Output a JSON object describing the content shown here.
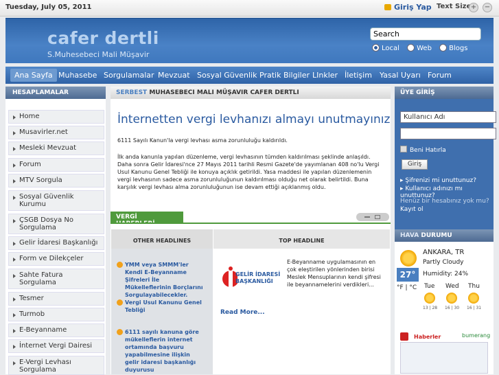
{
  "topbar": {
    "date": "Tuesday, July 05, 2011",
    "login": "Giriş Yap",
    "text_size": "Text Size",
    "size_plus": "+",
    "size_minus": "−"
  },
  "header": {
    "site_name": "cafer dertli",
    "subtitle": "S.Muhesebeci Mali Müşavir",
    "search_value": "Search",
    "radios": [
      {
        "label": "Local",
        "checked": true
      },
      {
        "label": "Web",
        "checked": false
      },
      {
        "label": "Blogs",
        "checked": false
      }
    ]
  },
  "nav": [
    "Ana Sayfa",
    "Muhasebe",
    "Sorgulamalar",
    "Mevzuat",
    "Sosyal Güvenlik",
    "Pratik Bilgiler",
    "LInkler",
    "İletişim",
    "Yasal Uyarı",
    "Forum"
  ],
  "left": {
    "title": "HESAPLAMALAR",
    "items": [
      "Home",
      "Musavirler.net",
      "Mesleki Mevzuat",
      "Forum",
      "MTV Sorgula",
      "Sosyal Güvenlik Kurumu",
      "ÇSGB Dosya No Sorgulama",
      "Gelir İdaresi Başkanlığı",
      "Form ve Dilekçeler",
      "Sahte Fatura Sorgulama",
      "Tesmer",
      "Turmob",
      "E-Beyanname",
      "İnternet Vergi Dairesi",
      "E-Vergi Levhası Sorgulama"
    ]
  },
  "main": {
    "head_accent": "SERBEST",
    "head_title": "MUHASEBECI MALI MÜŞAVIR CAFER DERTLI",
    "headline": "İnternetten vergi levhanızı almayı unutmayınız",
    "para1": "6111 Sayılı Kanun'la vergi levhası asma zorunluluğu kaldırıldı.",
    "para2": "İlk anda kanunla yapılan düzenleme, vergi levhasının tümden kaldırılması şeklinde anlaşıldı. Daha sonra Gelir İdaresi'nce 27 Mayıs 2011 tarihli Resmi Gazete'de yayımlanan 408 no'lu Vergi Usul Kanunu Genel Tebliği ile konuya açıklık getirildi. Yasa maddesi ile yapılan düzenlemenin vergi levhasının sadece asma zorunluluğunun kaldırılması olduğu net olarak belirtildi. Buna karşılık vergi levhası alma zorunluluğunun ise devam ettiği açıklanmış oldu.",
    "tab": "VERGİ HABERLERİ",
    "other_headlines": "OTHER HEADLINES",
    "top_headline": "TOP HEADLINE",
    "news": [
      "YMM veya SMMM'ler Kendi E-Beyanname Şifreleri İle Mükelleflerinin Borçlarını Sorgulayabilecekler.",
      "Vergi Usul Kanunu Genel Tebliği",
      "6111 sayılı kanuna göre mükelleflerin internet ortamında başvuru yapabilmesine ilişkin gelir idaresi başkanlığı duyurusu"
    ],
    "logo_text": "GELİR İDARESİ BAŞKANLIĞI",
    "top_text": "E-Beyanname uygulamasının en çok eleştirilen yönlerinden birisi Meslek Mensuplarının kendi şifresi ile beyannamelerini verdikleri...",
    "read_more": "Read More..."
  },
  "right": {
    "login_title": "ÜYE GİRİŞ",
    "username": "Kullanıcı Adı",
    "remember": "Beni Hatırla",
    "login_btn": "Giriş",
    "forgot_pw": "Şifrenizi mi unuttunuz?",
    "forgot_user": "Kullanıcı adınızı mı unuttunuz?",
    "no_account": "Henüz bir hesabınız yok mu?",
    "register": "Kayıt ol",
    "weather_a": "HAVA",
    "weather_b": "DURUMU",
    "city": "ANKARA, TR",
    "condition": "Partly Cloudy",
    "temp": "27°",
    "humidity": "Humidity: 24%",
    "units": "°F | °C",
    "forecast": [
      {
        "day": "Tue",
        "range": "13 | 28"
      },
      {
        "day": "Wed",
        "range": "16 | 30"
      },
      {
        "day": "Thu",
        "range": "16 | 31"
      }
    ],
    "partner1": "Haberler",
    "partner2": "bumerang"
  },
  "colors": {
    "brand_blue": "#2a5aa0",
    "green_tab": "#4f9a3c",
    "bullet_orange": "#f1a11b"
  }
}
